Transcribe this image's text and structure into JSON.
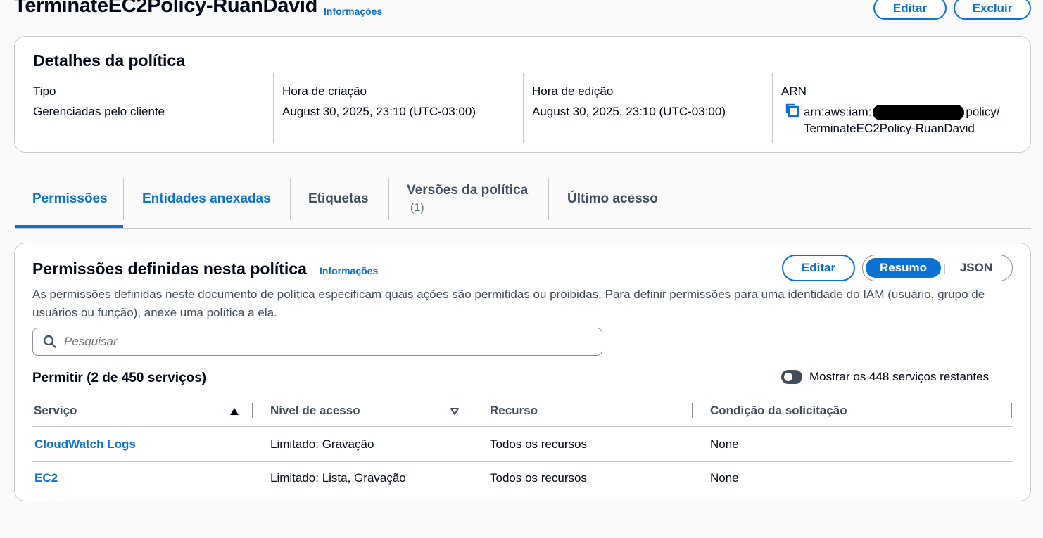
{
  "header": {
    "title": "TerminateEC2Policy-RuanDavid",
    "info_link": "Informações",
    "edit_button": "Editar",
    "delete_button": "Excluir"
  },
  "details": {
    "heading": "Detalhes da política",
    "type_label": "Tipo",
    "type_value": "Gerenciadas pelo cliente",
    "created_label": "Hora de criação",
    "created_value": "August 30, 2025, 23:10 (UTC-03:00)",
    "edited_label": "Hora de edição",
    "edited_value": "August 30, 2025, 23:10 (UTC-03:00)",
    "arn_label": "ARN",
    "arn_line1_prefix": "arn:aws:iam:",
    "arn_line1_suffix": "policy/",
    "arn_line2": "TerminateEC2Policy-RuanDavid",
    "icon": "copy-icon"
  },
  "tabs": [
    {
      "label": "Permissões",
      "active": true
    },
    {
      "label": "Entidades anexadas"
    },
    {
      "label": "Etiquetas"
    },
    {
      "label": "Versões da política",
      "count": "(1)"
    },
    {
      "label": "Último acesso"
    }
  ],
  "permissions": {
    "heading": "Permissões definidas nesta política",
    "info_link": "Informações",
    "edit_button": "Editar",
    "view_summary": "Resumo",
    "view_json": "JSON",
    "description": "As permissões definidas neste documento de política especificam quais ações são permitidas ou proibidas. Para definir permissões para uma identidade do IAM (usuário, grupo de usuários ou função), anexe uma política a ela.",
    "search_placeholder": "Pesquisar",
    "allow_heading": "Permitir (2 de 450 serviços)",
    "toggle_label": "Mostrar os 448 serviços restantes",
    "toggle_on": false,
    "columns": [
      "Serviço",
      "Nível de acesso",
      "Recurso",
      "Condição da solicitação"
    ],
    "rows": [
      {
        "service": "CloudWatch Logs",
        "access": "Limitado: Gravação",
        "resource": "Todos os recursos",
        "condition": "None"
      },
      {
        "service": "EC2",
        "access": "Limitado: Lista, Gravação",
        "resource": "Todos os recursos",
        "condition": "None"
      }
    ]
  },
  "colors": {
    "accent": "#0972d3",
    "text": "#000716",
    "border": "#c6c6cd"
  }
}
